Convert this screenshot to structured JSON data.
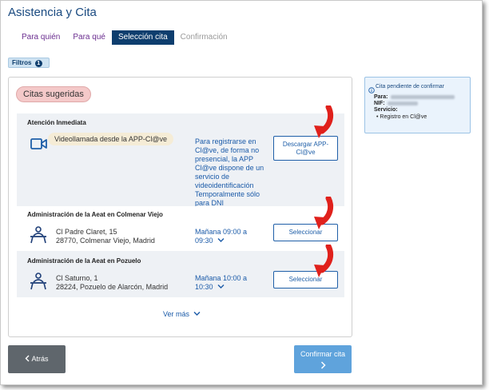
{
  "page": {
    "title": "Asistencia y Cita"
  },
  "steps": [
    {
      "label": "Para quién",
      "state": "done"
    },
    {
      "label": "Para qué",
      "state": "done"
    },
    {
      "label": "Selección cita",
      "state": "active"
    },
    {
      "label": "Confirmación",
      "state": "disabled"
    }
  ],
  "filters": {
    "label": "Filtros",
    "count": "1"
  },
  "suggestions": {
    "chip": "Citas sugeridas",
    "sections": [
      {
        "title": "Atención Inmediata",
        "icon": "video-camera-icon",
        "chip": "Videollamada desde la APP-Cl@ve",
        "info": "Para registrarse en Cl@ve, de forma no presencial, la APP Cl@ve dispone de un servicio de videoidentificación Temporalmente sólo para DNI",
        "button": "Descargar APP-Cl@ve"
      },
      {
        "title": "Administración de la Aeat en Colmenar Viejo",
        "icon": "office-desk-icon",
        "address_line1": "Cl Padre Claret, 15",
        "address_line2": "28770, Colmenar Viejo, Madrid",
        "time_line1": "Mañana 09:00 a",
        "time_line2": "09:30",
        "button": "Seleccionar"
      },
      {
        "title": "Administración de la Aeat en Pozuelo",
        "icon": "office-desk-icon",
        "address_line1": "Cl Saturno, 1",
        "address_line2": "28224, Pozuelo de Alarcón, Madrid",
        "time_line1": "Mañana 10:00 a",
        "time_line2": "10:30",
        "button": "Seleccionar"
      }
    ],
    "more": "Ver más"
  },
  "pending": {
    "title": "Cita pendiente de confirmar",
    "para_label": "Para:",
    "nif_label": "NIF:",
    "servicio_label": "Servicio:",
    "servicio_item": "Registro en Cl@ve"
  },
  "footer": {
    "back": "Atrás",
    "confirm": "Confirmar cita"
  },
  "colors": {
    "accent": "#0e3e6e",
    "link": "#1a5aa8",
    "annotation_arrow": "#e0211c"
  }
}
